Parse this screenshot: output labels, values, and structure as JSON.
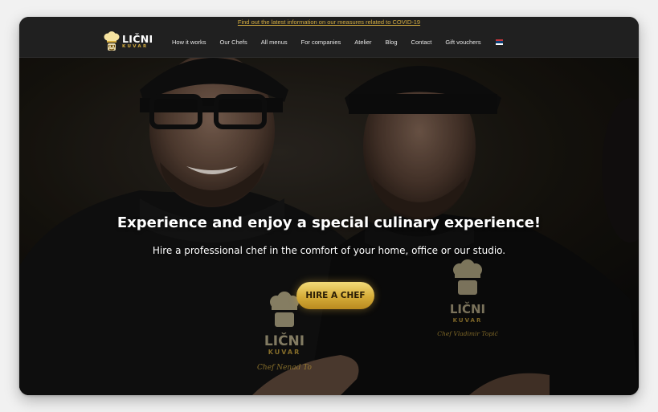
{
  "announcement": {
    "text": "Find out the latest information on our measures related to COVID-19"
  },
  "logo": {
    "main": "LIČNI",
    "sub": "KUVAR"
  },
  "nav": {
    "items": [
      "How it works",
      "Our Chefs",
      "All menus",
      "For companies",
      "Atelier",
      "Blog",
      "Contact",
      "Gift vouchers"
    ],
    "language_icon": "serbian-flag-icon"
  },
  "hero": {
    "title": "Experience and enjoy a special culinary experience!",
    "subtitle": "Hire a professional chef in the comfort of your home, office or our studio.",
    "cta": "HIRE A CHEF",
    "jacket_logo_left": {
      "main": "LIČNI",
      "sub": "KUVAR",
      "signature": "Chef Nenad To"
    },
    "jacket_logo_right": {
      "main": "LIČNI",
      "sub": "KUVAR",
      "signature": "Chef Vladimir Topić"
    }
  },
  "colors": {
    "accent_gold": "#d4ac3f",
    "nav_bg": "#202020",
    "page_bg": "#f1f1f1"
  }
}
